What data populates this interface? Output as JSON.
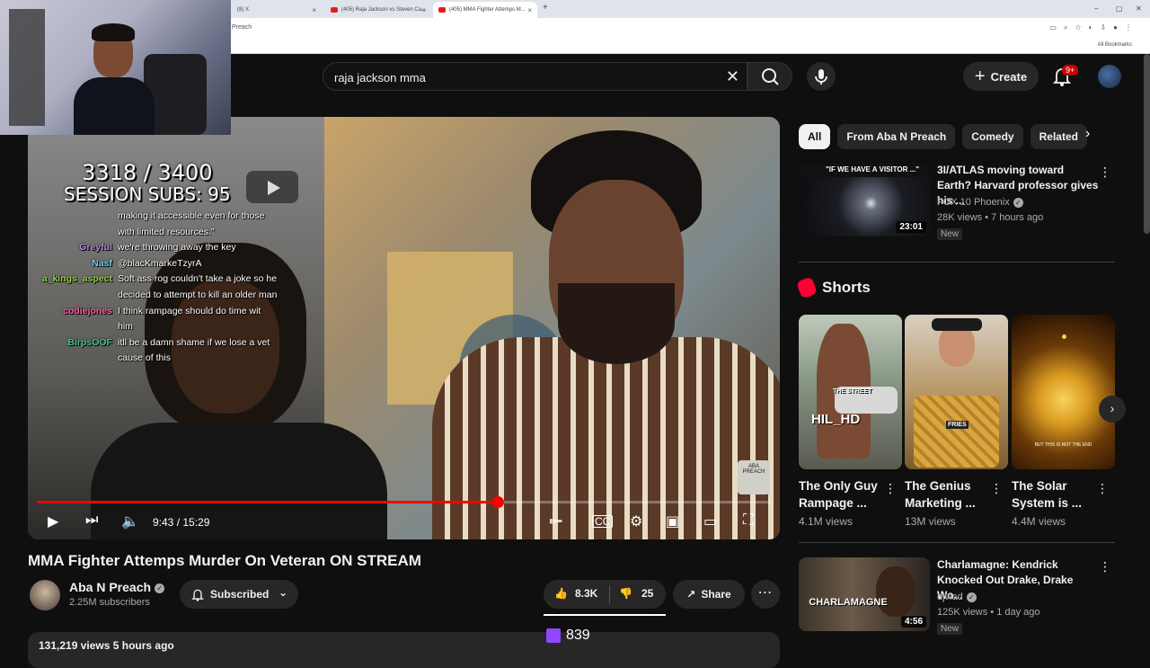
{
  "browser": {
    "tabs": [
      {
        "label": "(8) X"
      },
      {
        "label": "(405) Raja Jackson vs Steven Ca..."
      },
      {
        "label": "(405) MMA Fighter Attemps M..."
      }
    ],
    "new_tab": "+",
    "address_text": "Preach",
    "bookmarks_label": "All Bookmarks"
  },
  "webcam": {
    "description_icon": "streamer-webcam"
  },
  "header": {
    "search_value": "raja jackson mma",
    "create_label": "Create",
    "notif_count": "9+"
  },
  "player": {
    "session_line1": "3318 / 3400",
    "session_line2": "SESSION SUBS: 95",
    "time": "9:43 / 15:29",
    "progress_fraction": 0.6276,
    "chat": [
      {
        "user": "",
        "color": "#ffffff",
        "msg": "making it accessible even for those"
      },
      {
        "user": "",
        "color": "#ffffff",
        "msg": "with limited resources.\""
      },
      {
        "user": "Greyful",
        "color": "#b08ae0",
        "msg": "we're throwing away the key"
      },
      {
        "user": "Nasf",
        "color": "#6ad0e6",
        "msg": "@blacKmarkeTzyrA"
      },
      {
        "user": "a_kings_aspect",
        "color": "#8fd44a",
        "msg": "Soft ass rog couldn't take a joke so he"
      },
      {
        "user": "",
        "color": "#ffffff",
        "msg": "decided to attempt to kill an older man"
      },
      {
        "user": "codiejones",
        "color": "#ff5fa0",
        "msg": "I think rampage should do time wit"
      },
      {
        "user": "",
        "color": "#ffffff",
        "msg": "him"
      },
      {
        "user": "BirpsOOF",
        "color": "#4fc38a",
        "msg": "itll be a damn shame if we lose a vet"
      },
      {
        "user": "",
        "color": "#ffffff",
        "msg": "cause of this"
      }
    ],
    "watermark": "ABA PREACH"
  },
  "video": {
    "title": "MMA Fighter Attemps Murder On Veteran ON STREAM",
    "channel": "Aba N Preach",
    "subs": "2.25M subscribers",
    "subscribed_label": "Subscribed",
    "likes": "8.3K",
    "dislikes": "25",
    "share_label": "Share",
    "twitch_viewers": "839",
    "views_line": "131,219 views  5 hours ago"
  },
  "sidebar": {
    "chips": [
      "All",
      "From Aba N Preach",
      "Comedy",
      "Related"
    ],
    "recs": [
      {
        "title": "3I/ATLAS moving toward Earth? Harvard professor gives his ...",
        "channel": "FOX 10 Phoenix",
        "meta": "28K views • 7 hours ago",
        "badge": "New",
        "duration": "23:01",
        "thumb_text": "\"IF WE HAVE A VISITOR ...\""
      },
      {
        "title": "Charlamagne: Kendrick Knocked Out Drake, Drake Wo...",
        "channel": "djvlad",
        "meta": "125K views • 1 day ago",
        "badge": "New",
        "duration": "4:56",
        "thumb_text": "CHARLAMAGNE"
      }
    ],
    "shorts_title": "Shorts",
    "shorts": [
      {
        "title": "The Only Guy Rampage ...",
        "views": "4.1M views",
        "overlay": "THE STREET"
      },
      {
        "title": "The Genius Marketing ...",
        "views": "13M views",
        "overlay": "FRIES"
      },
      {
        "title": "The Solar System is ...",
        "views": "4.4M views",
        "overlay": "BUT THIS IS NOT THE END"
      }
    ]
  }
}
